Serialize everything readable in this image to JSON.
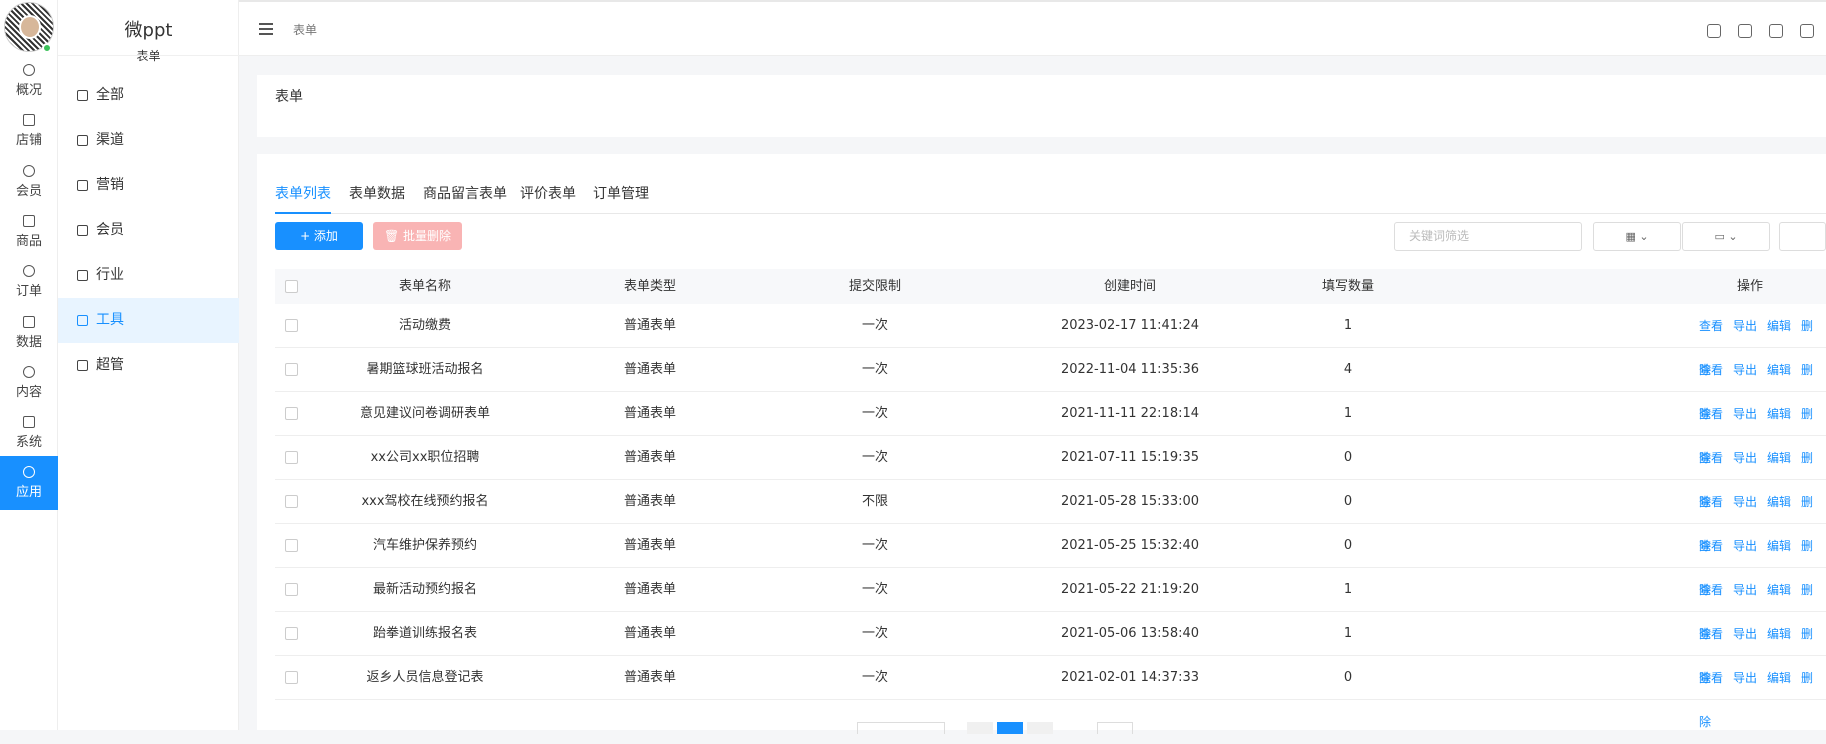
{
  "rail": {
    "items": [
      {
        "label": "概况",
        "icon": "dashboard-icon"
      },
      {
        "label": "店铺",
        "icon": "store-icon"
      },
      {
        "label": "会员",
        "icon": "user-icon"
      },
      {
        "label": "商品",
        "icon": "box-icon"
      },
      {
        "label": "订单",
        "icon": "clipboard-icon"
      },
      {
        "label": "数据",
        "icon": "pie-chart-icon"
      },
      {
        "label": "内容",
        "icon": "folder-icon"
      },
      {
        "label": "系统",
        "icon": "gear-icon"
      },
      {
        "label": "应用",
        "icon": "cube-icon"
      }
    ]
  },
  "sidebar": {
    "title": "微ppt",
    "subtitle": "表单",
    "items": [
      {
        "label": "全部",
        "icon": "cube-icon"
      },
      {
        "label": "渠道",
        "icon": "channel-icon"
      },
      {
        "label": "营销",
        "icon": "chart-line-icon"
      },
      {
        "label": "会员",
        "icon": "user-icon"
      },
      {
        "label": "行业",
        "icon": "briefcase-icon"
      },
      {
        "label": "工具",
        "icon": "wrench-icon"
      },
      {
        "label": "超管",
        "icon": "admin-icon"
      }
    ]
  },
  "header": {
    "breadcrumb": "表单"
  },
  "title_card": {
    "title": "表单"
  },
  "tabs": [
    "表单列表",
    "表单数据",
    "商品留言表单",
    "评价表单",
    "订单管理"
  ],
  "toolbar": {
    "add_label": "+ 添加",
    "batch_delete_label": "批量删除",
    "search_placeholder": "关键词筛选"
  },
  "table": {
    "headers": [
      "表单名称",
      "表单类型",
      "提交限制",
      "创建时间",
      "填写数量",
      "操作"
    ],
    "actions": [
      "查看",
      "导出",
      "编辑",
      "删除"
    ],
    "rows": [
      {
        "name": "活动缴费",
        "type": "普通表单",
        "limit": "一次",
        "created": "2023-02-17 11:41:24",
        "count": "1"
      },
      {
        "name": "暑期篮球班活动报名",
        "type": "普通表单",
        "limit": "一次",
        "created": "2022-11-04 11:35:36",
        "count": "4"
      },
      {
        "name": "意见建议问卷调研表单",
        "type": "普通表单",
        "limit": "一次",
        "created": "2021-11-11 22:18:14",
        "count": "1"
      },
      {
        "name": "xx公司xx职位招聘",
        "type": "普通表单",
        "limit": "一次",
        "created": "2021-07-11 15:19:35",
        "count": "0"
      },
      {
        "name": "xxx驾校在线预约报名",
        "type": "普通表单",
        "limit": "不限",
        "created": "2021-05-28 15:33:00",
        "count": "0"
      },
      {
        "name": "汽车维护保养预约",
        "type": "普通表单",
        "limit": "一次",
        "created": "2021-05-25 15:32:40",
        "count": "0"
      },
      {
        "name": "最新活动预约报名",
        "type": "普通表单",
        "limit": "一次",
        "created": "2021-05-22 21:19:20",
        "count": "1"
      },
      {
        "name": "跆拳道训练报名表",
        "type": "普通表单",
        "limit": "一次",
        "created": "2021-05-06 13:58:40",
        "count": "1"
      },
      {
        "name": "返乡人员信息登记表",
        "type": "普通表单",
        "limit": "一次",
        "created": "2021-02-01 14:37:33",
        "count": "0"
      }
    ]
  },
  "colors": {
    "primary": "#1890ff",
    "danger_disabled": "#f9b4b4",
    "active_bg": "#e8f4ff"
  }
}
